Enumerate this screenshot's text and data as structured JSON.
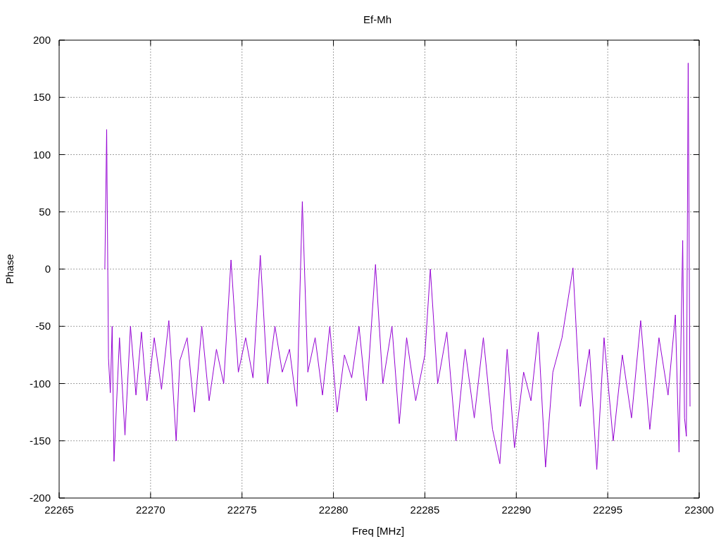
{
  "chart_data": {
    "type": "line",
    "grid": true,
    "title": "Ef-Mh",
    "xlabel": "Freq [MHz]",
    "ylabel": "Phase",
    "xlim": [
      22265,
      22300
    ],
    "ylim": [
      -200,
      200
    ],
    "xticks": [
      22265,
      22270,
      22275,
      22280,
      22285,
      22290,
      22295,
      22300
    ],
    "yticks": [
      -200,
      -150,
      -100,
      -50,
      0,
      50,
      100,
      150,
      200
    ],
    "x": [
      22267.5,
      22267.6,
      22267.7,
      22267.8,
      22267.9,
      22268.0,
      22268.3,
      22268.6,
      22268.9,
      22269.2,
      22269.5,
      22269.8,
      22270.2,
      22270.6,
      22271.0,
      22271.4,
      22271.6,
      22272.0,
      22272.4,
      22272.8,
      22273.2,
      22273.6,
      22274.0,
      22274.4,
      22274.8,
      22275.2,
      22275.6,
      22276.0,
      22276.4,
      22276.8,
      22277.2,
      22277.6,
      22278.0,
      22278.3,
      22278.6,
      22279.0,
      22279.4,
      22279.8,
      22280.2,
      22280.6,
      22281.0,
      22281.4,
      22281.8,
      22282.3,
      22282.7,
      22283.2,
      22283.6,
      22284.0,
      22284.5,
      22285.0,
      22285.3,
      22285.7,
      22286.2,
      22286.7,
      22287.2,
      22287.7,
      22288.2,
      22288.7,
      22289.1,
      22289.5,
      22289.9,
      22290.4,
      22290.8,
      22291.2,
      22291.6,
      22292.0,
      22292.5,
      22293.1,
      22293.5,
      22294.0,
      22294.4,
      22294.8,
      22295.3,
      22295.8,
      22296.3,
      22296.8,
      22297.3,
      22297.8,
      22298.3,
      22298.7,
      22298.9,
      22299.1,
      22299.2,
      22299.3,
      22299.4,
      22299.5
    ],
    "series": [
      {
        "color": "#9400d3",
        "values": [
          0,
          122,
          -78,
          -108,
          -50,
          -168,
          -60,
          -145,
          -50,
          -110,
          -55,
          -115,
          -60,
          -105,
          -45,
          -150,
          -80,
          -60,
          -125,
          -50,
          -115,
          -70,
          -100,
          8,
          -90,
          -60,
          -95,
          12,
          -100,
          -50,
          -90,
          -70,
          -120,
          59,
          -90,
          -60,
          -110,
          -50,
          -125,
          -75,
          -95,
          -50,
          -115,
          4,
          -100,
          -50,
          -135,
          -60,
          -115,
          -75,
          0,
          -100,
          -55,
          -150,
          -70,
          -130,
          -60,
          -140,
          -170,
          -70,
          -156,
          -90,
          -115,
          -55,
          -173,
          -90,
          -60,
          1,
          -120,
          -70,
          -175,
          -60,
          -150,
          -75,
          -130,
          -45,
          -140,
          -60,
          -110,
          -40,
          -160,
          25,
          -130,
          -146,
          180,
          -120
        ]
      }
    ]
  }
}
